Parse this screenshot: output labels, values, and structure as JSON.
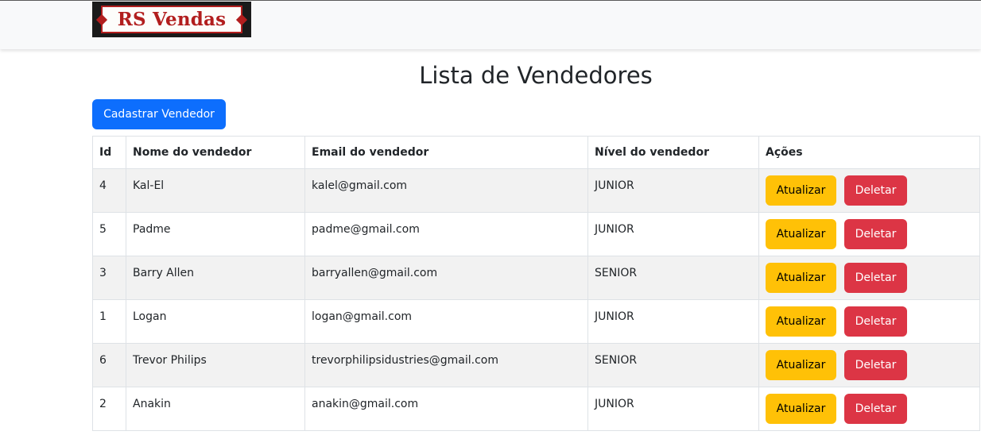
{
  "brand": {
    "logo_text": "RS Vendas"
  },
  "page": {
    "title": "Lista de Vendedores"
  },
  "toolbar": {
    "create_label": "Cadastrar Vendedor"
  },
  "table": {
    "headers": [
      "Id",
      "Nome do vendedor",
      "Email do vendedor",
      "Nível do vendedor",
      "Ações"
    ],
    "rows": [
      {
        "id": "4",
        "name": "Kal-El",
        "email": "kalel@gmail.com",
        "level": "JUNIOR"
      },
      {
        "id": "5",
        "name": "Padme",
        "email": "padme@gmail.com",
        "level": "JUNIOR"
      },
      {
        "id": "3",
        "name": "Barry Allen",
        "email": "barryallen@gmail.com",
        "level": "SENIOR"
      },
      {
        "id": "1",
        "name": "Logan",
        "email": "logan@gmail.com",
        "level": "JUNIOR"
      },
      {
        "id": "6",
        "name": "Trevor Philips",
        "email": "trevorphilipsidustries@gmail.com",
        "level": "SENIOR"
      },
      {
        "id": "2",
        "name": "Anakin",
        "email": "anakin@gmail.com",
        "level": "JUNIOR"
      }
    ],
    "update_label": "Atualizar",
    "delete_label": "Deletar"
  },
  "colors": {
    "primary": "#0d6efd",
    "warning": "#ffc107",
    "danger": "#dc3545",
    "navbar_bg": "#f8f9fa",
    "striped_row": "#f2f2f2"
  }
}
